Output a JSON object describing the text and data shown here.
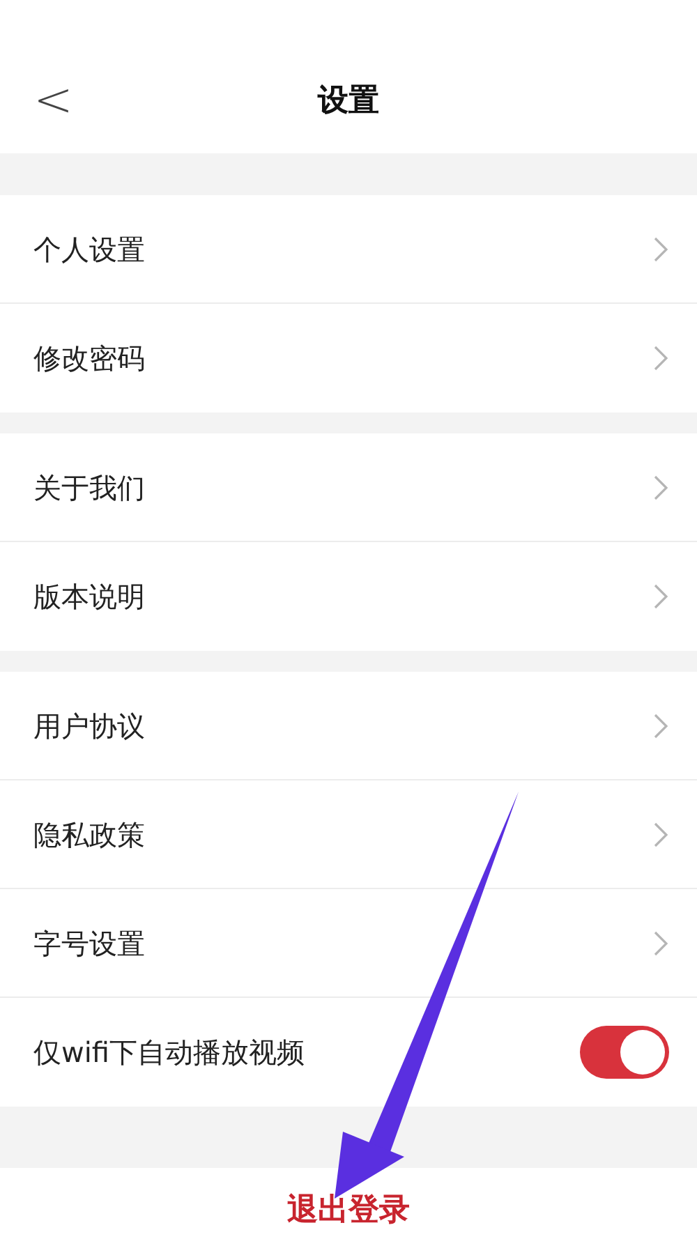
{
  "header": {
    "back": "<",
    "title": "设置"
  },
  "groups": [
    {
      "items": [
        {
          "kind": "link",
          "label": "个人设置"
        },
        {
          "kind": "link",
          "label": "修改密码"
        }
      ]
    },
    {
      "items": [
        {
          "kind": "link",
          "label": "关于我们"
        },
        {
          "kind": "link",
          "label": "版本说明"
        }
      ]
    },
    {
      "items": [
        {
          "kind": "link",
          "label": "用户协议"
        },
        {
          "kind": "link",
          "label": "隐私政策"
        },
        {
          "kind": "link",
          "label": "字号设置"
        },
        {
          "kind": "toggle",
          "label": "仅wifi下自动播放视频",
          "on": true
        }
      ]
    }
  ],
  "logout": "退出登录"
}
